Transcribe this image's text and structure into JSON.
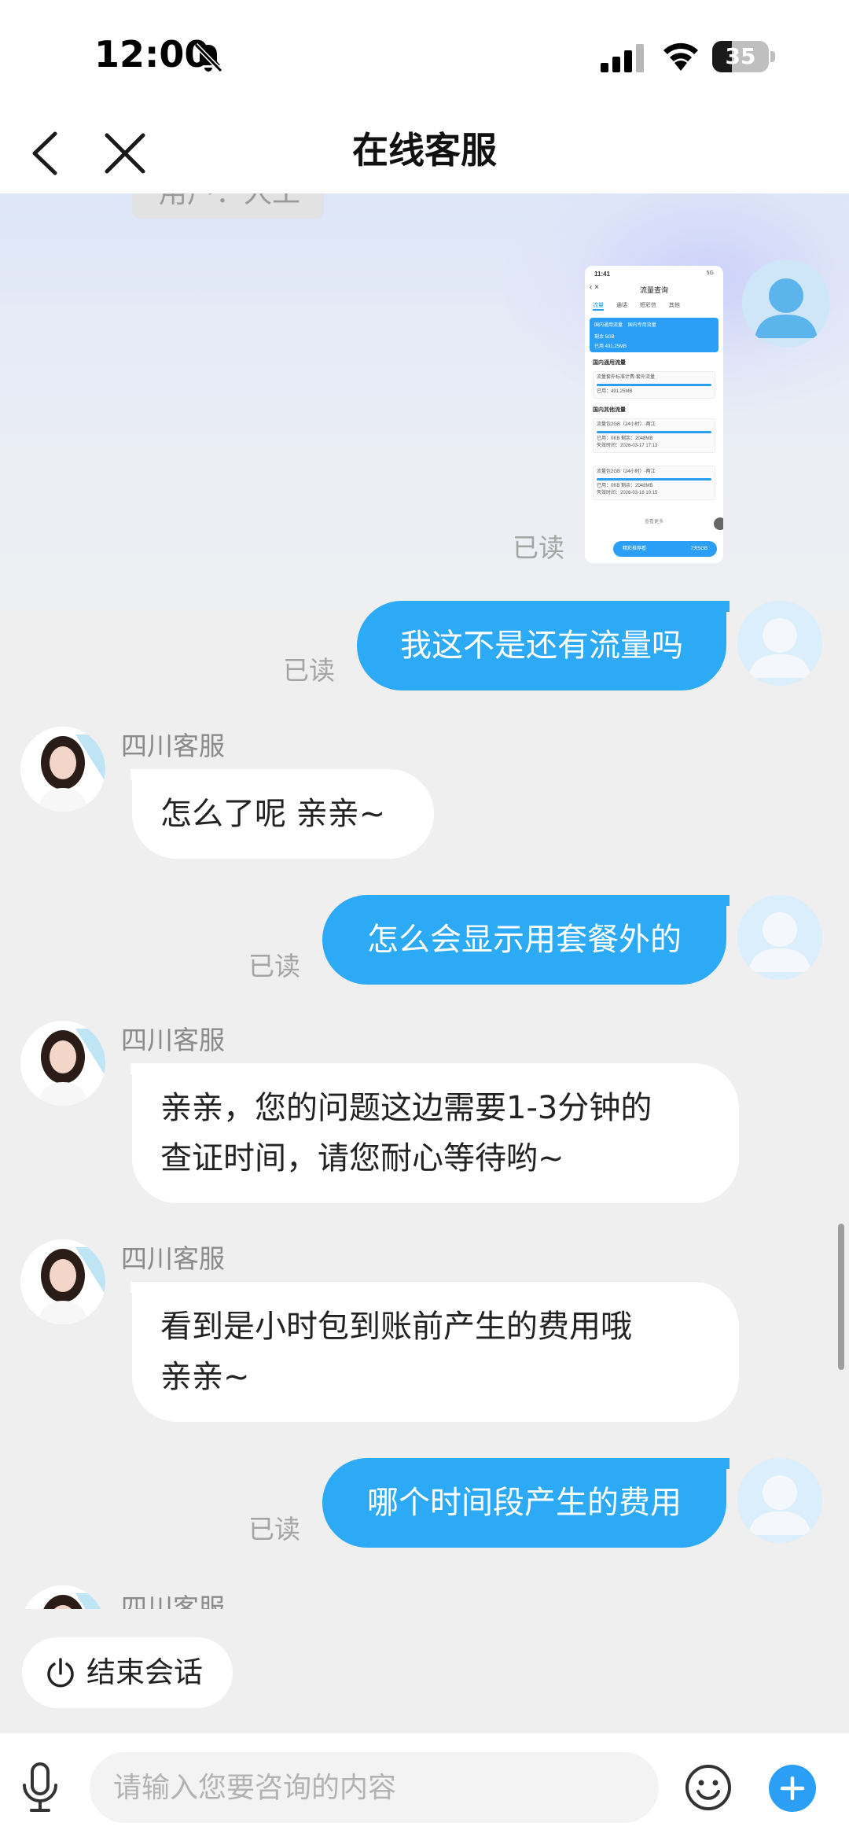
{
  "status_bar": {
    "time": "12:00",
    "battery_level": "35",
    "battery_fraction": 0.35,
    "icons": [
      "bell-muted-icon",
      "signal-icon",
      "wifi-icon",
      "battery-icon"
    ]
  },
  "nav": {
    "title": "在线客服",
    "icons": [
      "back-icon",
      "close-icon"
    ]
  },
  "chat": {
    "clipped_top_bubble": "用户：人工",
    "image_message": {
      "read_label": "已读",
      "thumbnail": {
        "status_time": "11:41",
        "status_right": "5G",
        "title": "流量查询",
        "tabs": [
          "流量",
          "通话",
          "短彩信",
          "其他"
        ],
        "card_left": "国内通用流量",
        "card_right": "国内专用流量",
        "card_line1": "剩余 5GB",
        "card_line2": "已用 491.25MB",
        "section1": "国内通用流量",
        "box1_title": "流量套外标准计费-套外流量",
        "box1_line": "已用：491.25MB",
        "section2": "国内其他流量",
        "box2_title": "流量包2GB（24小时）-两江",
        "box2_line1": "已用：0KB    剩余：2048MB",
        "box2_line2": "失效时间：2026-03-17 17:13",
        "box3_title": "流量包2GB（24小时）-两江",
        "box3_line1": "已用：0KB    剩余：2048MB",
        "box3_line2": "失效时间：2026-03-18 10:15",
        "more": "查看更多",
        "btn_left": "精彩推荐看",
        "btn_right": "7天5GB"
      }
    },
    "messages": [
      {
        "from": "user",
        "text": "我这不是还有流量吗",
        "read_label": "已读"
      },
      {
        "from": "agent",
        "name": "四川客服",
        "text": "怎么了呢  亲亲~"
      },
      {
        "from": "user",
        "text": "怎么会显示用套餐外的",
        "read_label": "已读"
      },
      {
        "from": "agent",
        "name": "四川客服",
        "line1": "亲亲，您的问题这边需要1-3分钟的",
        "line2": "查证时间，请您耐心等待哟~"
      },
      {
        "from": "agent",
        "name": "四川客服",
        "line1": "看到是小时包到账前产生的费用哦",
        "line2": "亲亲~"
      },
      {
        "from": "user",
        "text": "哪个时间段产生的费用",
        "read_label": "已读"
      },
      {
        "from": "agent",
        "name": "四川客服"
      }
    ]
  },
  "end_session": {
    "label": "结束会话",
    "icon": "power-icon"
  },
  "input_bar": {
    "placeholder": "请输入您要咨询的内容",
    "value": "",
    "icons": [
      "mic-icon",
      "emoji-icon",
      "plus-icon"
    ]
  },
  "colors": {
    "user_bubble": "#2daaf5",
    "agent_bubble": "#ffffff",
    "accent": "#2b9ef6",
    "page_bg": "#efefef"
  }
}
